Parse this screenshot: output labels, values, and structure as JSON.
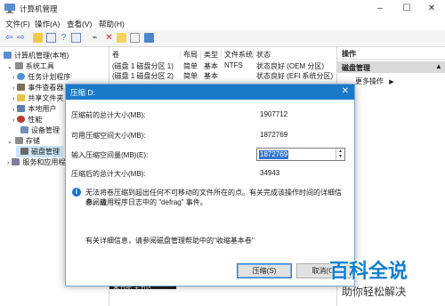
{
  "window": {
    "title": "计算机管理",
    "colors": {
      "titlebar": "#ffffff",
      "dialog_title": "#1979ca",
      "selection": "#3375d6"
    }
  },
  "menu": [
    "文件(F)",
    "操作(A)",
    "查看(V)",
    "帮助(H)"
  ],
  "tree": {
    "root": "计算机管理(本地)",
    "items": [
      {
        "label": "系统工具",
        "level": 1,
        "icon": "tools-icon"
      },
      {
        "label": "任务计划程序",
        "level": 2,
        "icon": "clock-icon"
      },
      {
        "label": "事件查看器",
        "level": 2,
        "icon": "event-log-icon"
      },
      {
        "label": "共享文件夹",
        "level": 2,
        "icon": "folder-icon"
      },
      {
        "label": "本地用户",
        "level": 2,
        "icon": "users-icon"
      },
      {
        "label": "性能",
        "level": 2,
        "icon": "performance-icon"
      },
      {
        "label": "设备管理",
        "level": 2,
        "icon": "device-icon"
      },
      {
        "label": "存储",
        "level": 1,
        "icon": "storage-icon"
      },
      {
        "label": "磁盘管理",
        "level": 2,
        "icon": "disk-icon",
        "selected": true
      },
      {
        "label": "服务和应用程序",
        "level": 1,
        "icon": "services-icon"
      }
    ]
  },
  "volumes": {
    "columns": [
      "卷",
      "布局",
      "类型",
      "文件系统",
      "状态"
    ],
    "rows": [
      [
        "(磁盘 1 磁盘分区 1)",
        "简单",
        "基本",
        "NTFS",
        "状态良好 (OEM 分区)"
      ],
      [
        "(磁盘 1 磁盘分区 2)",
        "简单",
        "基本",
        "",
        "状态良好 (EFI 系统分区)"
      ]
    ]
  },
  "actions": {
    "header": "操作",
    "section": "磁盘管理",
    "more": "更多操作"
  },
  "dialog": {
    "title": "压缩 D:",
    "rows": [
      {
        "label": "压缩前的总计大小(MB):",
        "value": "1907712"
      },
      {
        "label": "可用压缩空间大小(MB):",
        "value": "1872769"
      },
      {
        "label": "输入压缩空间量(MB)(E):",
        "value": "1872769"
      },
      {
        "label": "压缩后的总计大小(MB):",
        "value": "34943"
      }
    ],
    "info_line1": "无法将卷压缩到超出任何不可移动的文件所在的点。有关完成该操作时间的详细信息，请",
    "info_line2": "参阅应用程序日志中的 \"defrag\" 事件。",
    "help_text": "有关详细信息，请参阅磁盘管理帮助中的\"收缩基本卷\"",
    "buttons": {
      "shrink": "压缩(S)",
      "cancel": "取消(C)"
    }
  },
  "bottom_fragment": "未分配     主分区",
  "watermark": {
    "line1": "百科全说",
    "line2": "助你轻松解决"
  }
}
